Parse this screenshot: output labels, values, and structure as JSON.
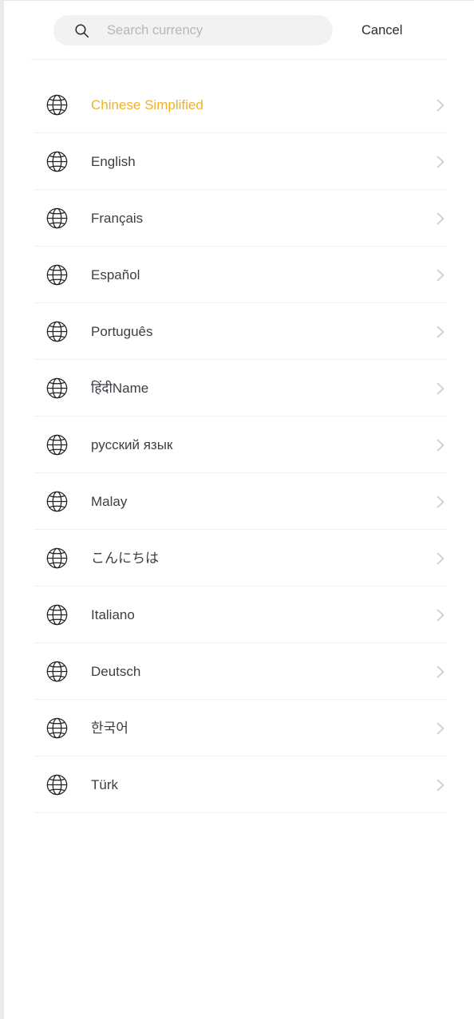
{
  "search": {
    "icon": "search-icon",
    "placeholder": "Search currency",
    "value": "",
    "cancel_label": "Cancel"
  },
  "colors": {
    "highlight": "#efb12c",
    "text": "#3a3f44",
    "placeholder": "#b4b7bb",
    "field_background": "#f2f2f3",
    "divider": "#f1f1f2",
    "chevron": "#c9ccd1"
  },
  "language_list": {
    "row_icon": "globe-icon",
    "row_accessory_icon": "chevron-right-icon",
    "items": [
      {
        "label": "Chinese Simplified",
        "selected": true
      },
      {
        "label": "English",
        "selected": false
      },
      {
        "label": "Français",
        "selected": false
      },
      {
        "label": "Español",
        "selected": false
      },
      {
        "label": "Português",
        "selected": false
      },
      {
        "label": "हिंदीName",
        "selected": false
      },
      {
        "label": "русский язык",
        "selected": false
      },
      {
        "label": "Malay",
        "selected": false
      },
      {
        "label": "こんにちは",
        "selected": false
      },
      {
        "label": "Italiano",
        "selected": false
      },
      {
        "label": "Deutsch",
        "selected": false
      },
      {
        "label": "한국어",
        "selected": false
      },
      {
        "label": "Türk",
        "selected": false
      }
    ]
  }
}
